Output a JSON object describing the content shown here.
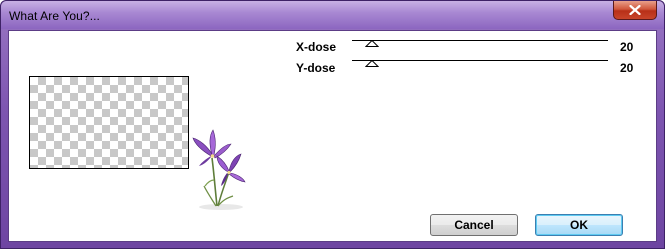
{
  "window": {
    "title": "What Are You?..."
  },
  "sliders": [
    {
      "label": "X-dose",
      "value": "20",
      "fraction": 0.08
    },
    {
      "label": "Y-dose",
      "value": "20",
      "fraction": 0.08
    }
  ],
  "buttons": {
    "cancel_label": "Cancel",
    "ok_label": "OK"
  },
  "icons": {
    "close": "close-icon",
    "decoration": "iris-flower-icon"
  },
  "colors": {
    "titlebar": "#a989d3",
    "frame": "#7d55b0",
    "close_button": "#c8442a",
    "ok_border": "#3c7fb1"
  }
}
